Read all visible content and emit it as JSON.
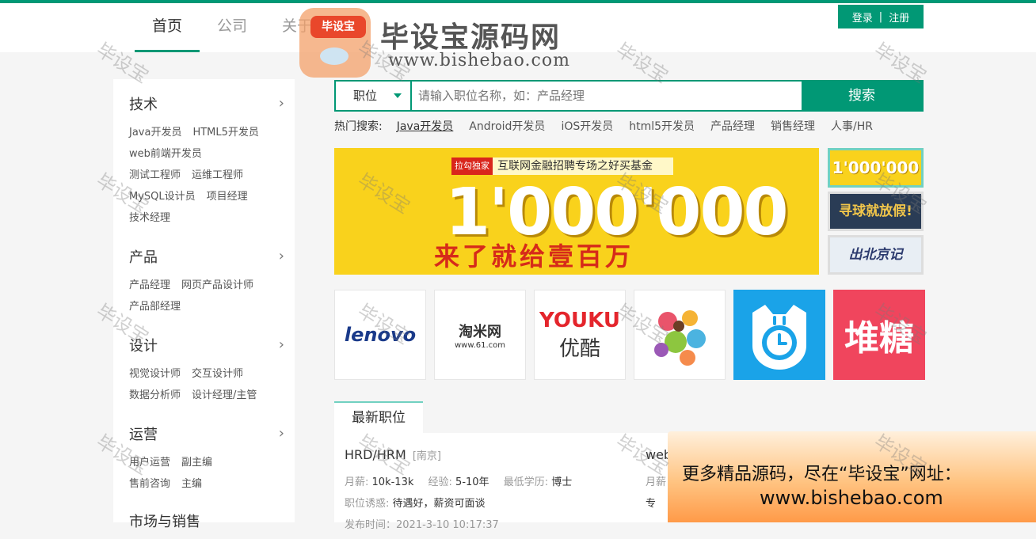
{
  "header": {
    "nav": [
      "首页",
      "公司",
      "关于"
    ],
    "auth": {
      "login": "登录",
      "sep": "|",
      "register": "注册"
    }
  },
  "watermark": {
    "badge": "毕设宝",
    "site": "毕设宝源码网",
    "url": "www.bishebao.com",
    "stamp": "毕设宝"
  },
  "sidebar": {
    "categories": [
      {
        "title": "技术",
        "links": [
          "Java开发员",
          "HTML5开发员",
          "web前端开发员",
          "测试工程师",
          "运维工程师",
          "MySQL设计员",
          "项目经理",
          "技术经理"
        ]
      },
      {
        "title": "产品",
        "links": [
          "产品经理",
          "网页产品设计师",
          "产品部经理"
        ]
      },
      {
        "title": "设计",
        "links": [
          "视觉设计师",
          "交互设计师",
          "数据分析师",
          "设计经理/主管"
        ]
      },
      {
        "title": "运营",
        "links": [
          "用户运营",
          "副主编",
          "售前咨询",
          "主编"
        ]
      },
      {
        "title": "市场与销售",
        "links": []
      }
    ]
  },
  "search": {
    "type_label": "职位",
    "placeholder": "请输入职位名称，如：产品经理",
    "button": "搜索"
  },
  "hot": {
    "label": "热门搜索:",
    "items": [
      "Java开发员",
      "Android开发员",
      "iOS开发员",
      "html5开发员",
      "产品经理",
      "销售经理",
      "人事/HR"
    ]
  },
  "banner": {
    "badge": "拉勾独家",
    "promo": "互联网金融招聘专场之好买基金",
    "big": "1'000'000",
    "sub": "来了就给壹百万"
  },
  "thumbs": [
    "1'000'000",
    "寻球就放假!",
    "出北京记"
  ],
  "logos": {
    "lenovo": "lenovo",
    "taomi_name": "淘米网",
    "taomi_url": "www.61.com",
    "youku_en": "YOUKU",
    "youku_cn": "优酷",
    "duitang": "堆糖"
  },
  "tabs": {
    "latest": "最新职位"
  },
  "jobs": [
    {
      "title": "HRD/HRM",
      "city": "[南京]",
      "salary_label": "月薪:",
      "salary": "10k-13k",
      "exp_label": "经验:",
      "exp": "5-10年",
      "edu_label": "最低学历:",
      "edu": "博士",
      "perk_label": "职位诱惑:",
      "perk": "待遇好，薪资可面谈",
      "time": "发布时间：2021-3-10 10:17:37"
    },
    {
      "title": "web",
      "salary_label": "月薪",
      "extra": "专"
    }
  ],
  "ad": {
    "line1": "更多精品源码，尽在“毕设宝”网址：",
    "line2": "www.bishebao.com"
  },
  "colors": {
    "brand": "#019875",
    "accent_light": "#71d1c1",
    "banner_yellow": "#f9d21c"
  }
}
